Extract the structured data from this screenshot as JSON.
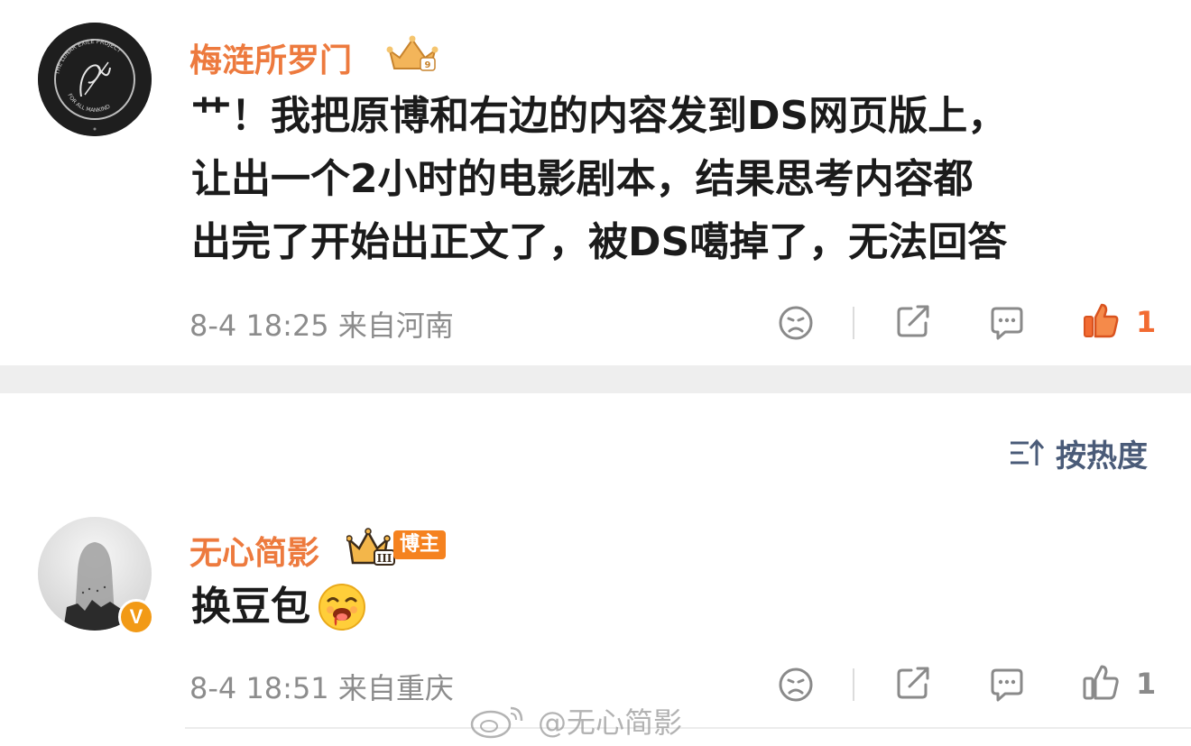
{
  "comments": [
    {
      "user": "梅涟所罗门",
      "avatar_ring_text": "THE LUNAR EXILE PROJECT",
      "avatar_bottom_text": "FOR ALL MANKIND",
      "text_lines": [
        "艹！我把原博和右边的内容发到DS网页版上，",
        "让出一个2小时的电影剧本，结果思考内容都",
        "出完了开始出正文了，被DS噶掉了，无法回答"
      ],
      "meta": "8-4 18:25  来自河南",
      "like_count": "1",
      "liked": true
    },
    {
      "user": "无心简影",
      "badge_label": "博主",
      "badge_level": "III",
      "verified_mark": "V",
      "text_lines": [
        "换豆包"
      ],
      "meta": "8-4 18:51  来自重庆",
      "like_count": "1",
      "liked": false
    }
  ],
  "sort": {
    "label": "按热度"
  },
  "watermark": "@无心简影",
  "colors": {
    "username": "#ed7a3e",
    "like_active": "#f26b32",
    "icon_gray": "#8a8a8a",
    "sort_text": "#4a5b78",
    "divider_band": "#eeeeee"
  },
  "icons": [
    "sad-face-icon",
    "share-icon",
    "comment-icon",
    "thumbs-up-icon",
    "sort-icon",
    "crown-badge-icon",
    "weibo-logo-icon"
  ]
}
